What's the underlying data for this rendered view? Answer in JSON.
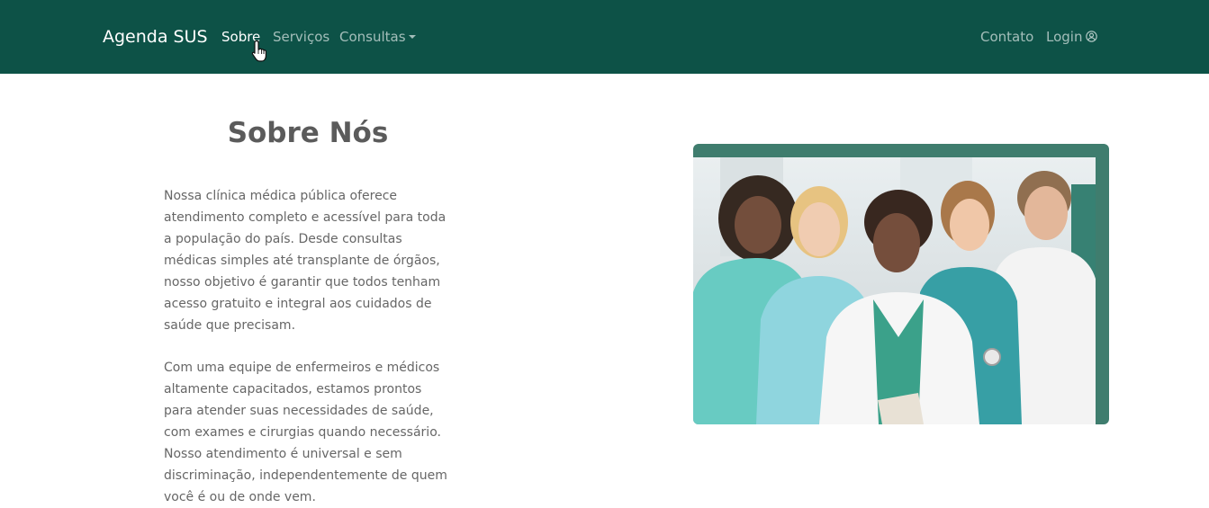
{
  "navbar": {
    "brand": "Agenda SUS",
    "links": {
      "sobre": "Sobre",
      "servicos": "Serviços",
      "consultas": "Consultas",
      "contato": "Contato",
      "login": "Login"
    },
    "background_color": "#0d5247"
  },
  "about": {
    "title": "Sobre Nós",
    "paragraph1": "Nossa clínica médica pública oferece atendimento completo e acessível para toda a população do país. Desde consultas médicas simples até transplante de órgãos, nosso objetivo é garantir que todos tenham acesso gratuito e integral aos cuidados de saúde que precisam.",
    "paragraph2": "Com uma equipe de enfermeiros e médicos altamente capacitados, estamos prontos para atender suas necessidades de saúde, com exames e cirurgias quando necessário. Nosso atendimento é universal e sem discriminação, independentemente de quem você é ou de onde vem."
  },
  "icons": {
    "login": "user-circle-icon",
    "cursor": "hand-pointer-icon"
  }
}
